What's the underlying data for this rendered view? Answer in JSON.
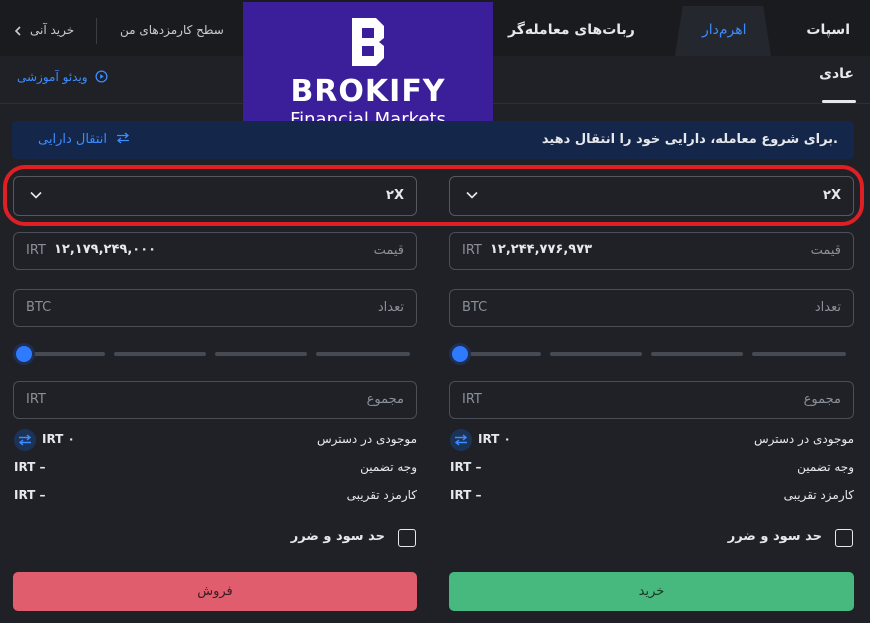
{
  "nav": {
    "tabs": [
      "اسپات",
      "اهرم‌دار",
      "ربات‌های معامله‌گر"
    ],
    "active_tab": "اهرم‌دار",
    "fee_level": "سطح کارمزدهای من",
    "instant_buy": "خرید آنی"
  },
  "subnav": {
    "tab": "عادی",
    "video_tutorial": "ویدئو آموزشی"
  },
  "logo": {
    "brand": "BROKIFY",
    "tagline": "Financial Markets"
  },
  "banner": {
    "message": "برای شروع معامله، دارایی خود را انتقال دهید.",
    "transfer_label": "انتقال دارایی"
  },
  "buy": {
    "leverage": "۲X",
    "price_label": "قیمت",
    "price_value": "۱۲,۲۴۴,۷۷۶,۹۷۳",
    "price_unit": "IRT",
    "amount_label": "تعداد",
    "amount_unit": "BTC",
    "total_label": "مجموع",
    "total_unit": "IRT",
    "slider_fraction": 0,
    "available_label": "موجودی در دسترس",
    "available_value": "IRT ۰",
    "margin_label": "وجه تضمین",
    "margin_value": "IRT –",
    "fee_label": "کارمزد تقریبی",
    "fee_value": "IRT –",
    "tp_sl_label": "حد سود و ضرر",
    "button_label": "خرید"
  },
  "sell": {
    "leverage": "۲X",
    "price_label": "قیمت",
    "price_value": "۱۲,۱۷۹,۲۴۹,۰۰۰",
    "price_unit": "IRT",
    "amount_label": "تعداد",
    "amount_unit": "BTC",
    "total_label": "مجموع",
    "total_unit": "IRT",
    "slider_fraction": 0,
    "available_label": "موجودی در دسترس",
    "available_value": "IRT ۰",
    "margin_label": "وجه تضمین",
    "margin_value": "IRT –",
    "fee_label": "کارمزد تقریبی",
    "fee_value": "IRT –",
    "tp_sl_label": "حد سود و ضرر",
    "button_label": "فروش"
  },
  "colors": {
    "accent": "#2f7bff",
    "buy": "#47b97e",
    "sell": "#e05d6d",
    "highlight": "#e01f25"
  }
}
